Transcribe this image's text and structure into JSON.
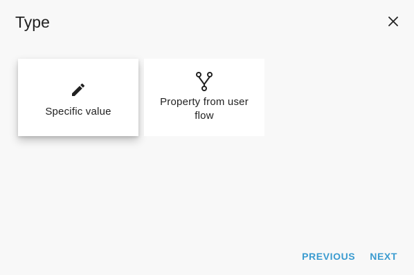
{
  "dialog": {
    "title": "Type",
    "close_icon": "close-icon"
  },
  "options": [
    {
      "label": "Specific value",
      "icon": "pencil-icon",
      "selected": true
    },
    {
      "label": "Property from user flow",
      "icon": "fork-icon",
      "selected": false
    }
  ],
  "actions": {
    "previous_label": "PREVIOUS",
    "next_label": "NEXT"
  },
  "colors": {
    "accent": "#3a9bd0",
    "background": "#f8f8f8",
    "card": "#ffffff",
    "text": "#212121"
  }
}
